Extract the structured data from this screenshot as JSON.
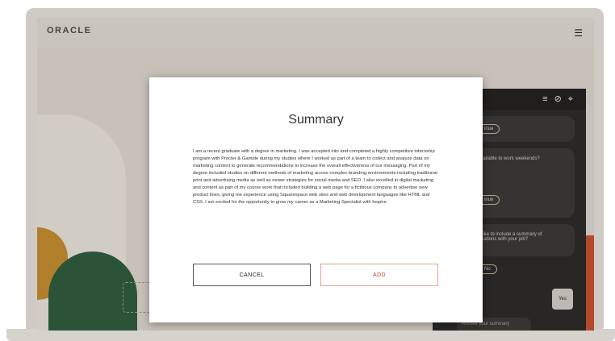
{
  "header": {
    "logo": "ORACLE",
    "menu_icon": "hamburger-icon"
  },
  "chat": {
    "header_icons": [
      "list-icon",
      "mute-icon",
      "collapse-icon"
    ],
    "messages": [
      {
        "text": "inue"
      },
      {
        "text": "available to work weekends?"
      },
      {
        "text": "inue"
      },
      {
        "text": "u like to include a summary of\nifications with your job?"
      },
      {
        "text": "No"
      }
    ],
    "yes_label": "Yes",
    "review_label": "Review your summary"
  },
  "modal": {
    "title": "Summary",
    "body": "I am a recent graduate with a degree in marketing. I was accepted into and completed a highly competitive internship program with Procter & Gamble during my studies where I worked as part of a team to collect and analyze data on marketing content to generate recommendations to increase the overall effectiveness of our messaging. Part of my degree included studies on different methods of marketing across complex branding environments including traditional print and advertising media as well as newer strategies for social media and SEO. I also excelled in digital marketing and content as part of my course work that included building a web page for a fictitious company to advertise new product lines, giving me experience using Squarespace web sites and web development languages like HTML and CSS. I am excited for the opportunity to grow my career as a Marketing Specialist with Inspire.",
    "cancel_label": "CANCEL",
    "add_label": "ADD"
  },
  "colors": {
    "accent": "#c74634",
    "chat_bg": "#2c2b2a"
  }
}
